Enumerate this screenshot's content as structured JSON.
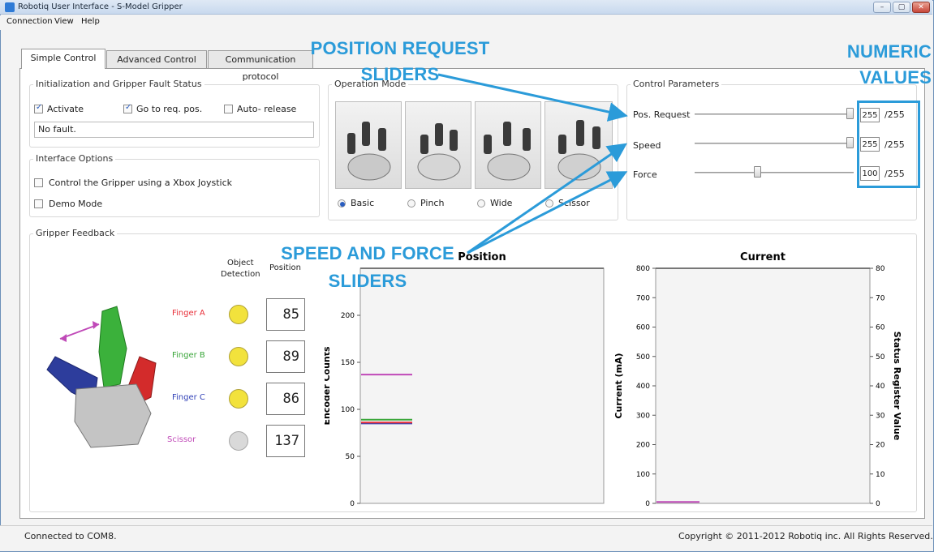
{
  "window": {
    "title": "Robotiq User Interface - S-Model Gripper",
    "buttons": [
      "–",
      "▢",
      "✕"
    ]
  },
  "menu": [
    "Connection",
    "View",
    "Help"
  ],
  "tabs": [
    "Simple Control",
    "Advanced Control",
    "Communication protocol"
  ],
  "init": {
    "title": "Initialization and Gripper Fault Status",
    "activate": {
      "label": "Activate",
      "checked": true
    },
    "goto": {
      "label": "Go to req. pos.",
      "checked": true
    },
    "auto": {
      "label": "Auto- release",
      "checked": false
    },
    "fault": "No fault."
  },
  "interface": {
    "title": "Interface Options",
    "xbox": {
      "label": "Control the Gripper using a Xbox Joystick",
      "checked": false
    },
    "demo": {
      "label": "Demo Mode",
      "checked": false
    }
  },
  "mode": {
    "title": "Operation Mode",
    "options": [
      "Basic",
      "Pinch",
      "Wide",
      "Scissor"
    ],
    "selected": "Basic"
  },
  "params": {
    "title": "Control Parameters",
    "rows": [
      {
        "label": "Pos. Request",
        "value": "255",
        "max": "/255",
        "level": 1.0
      },
      {
        "label": "Speed",
        "value": "255",
        "max": "/255",
        "level": 1.0
      },
      {
        "label": "Force",
        "value": "100",
        "max": "/255",
        "level": 0.39
      }
    ]
  },
  "feedback": {
    "title": "Gripper Feedback",
    "col_detection": "Object\nDetection",
    "col_position": "Position",
    "fingers": [
      {
        "name": "Finger A",
        "color": "#e8303a",
        "detected": true,
        "position": "85"
      },
      {
        "name": "Finger B",
        "color": "#3aa63a",
        "detected": true,
        "position": "89"
      },
      {
        "name": "Finger C",
        "color": "#3343b8",
        "detected": true,
        "position": "86"
      },
      {
        "name": "Scissor",
        "color": "#c04ab8",
        "detected": false,
        "position": "137"
      }
    ]
  },
  "chart_data": [
    {
      "type": "line",
      "title": "Position",
      "ylabel": "Encoder Counts",
      "ylim": [
        0,
        250
      ],
      "yticks": [
        "0",
        "50",
        "100",
        "150",
        "200"
      ],
      "series": [
        {
          "color": "#3343b8",
          "values": [
            85
          ]
        },
        {
          "color": "#e8303a",
          "values": [
            86
          ]
        },
        {
          "color": "#3aa63a",
          "values": [
            89
          ]
        },
        {
          "color": "#c04ab8",
          "values": [
            137
          ]
        }
      ]
    },
    {
      "type": "line",
      "title": "Current",
      "ylabel": "Current (mA)",
      "ylabel_right": "Status Register Value",
      "ylim": [
        0,
        800
      ],
      "ylim_right": [
        0,
        80
      ],
      "yticks": [
        "0",
        "100",
        "200",
        "300",
        "400",
        "500",
        "600",
        "700",
        "800"
      ],
      "yticks_right": [
        "0",
        "10",
        "20",
        "30",
        "40",
        "50",
        "60",
        "70",
        "80"
      ],
      "series": [
        {
          "color": "#c04ab8",
          "values": [
            5
          ]
        }
      ]
    }
  ],
  "annotations": {
    "pos_req": "POSITION REQUEST\nSLIDERS",
    "numeric": "NUMERIC\nVALUES",
    "speed_force": "SPEED AND FORCE\nSLIDERS"
  },
  "status": {
    "left": "Connected to COM8.",
    "right": "Copyright © 2011-2012 Robotiq inc. All Rights Reserved."
  }
}
